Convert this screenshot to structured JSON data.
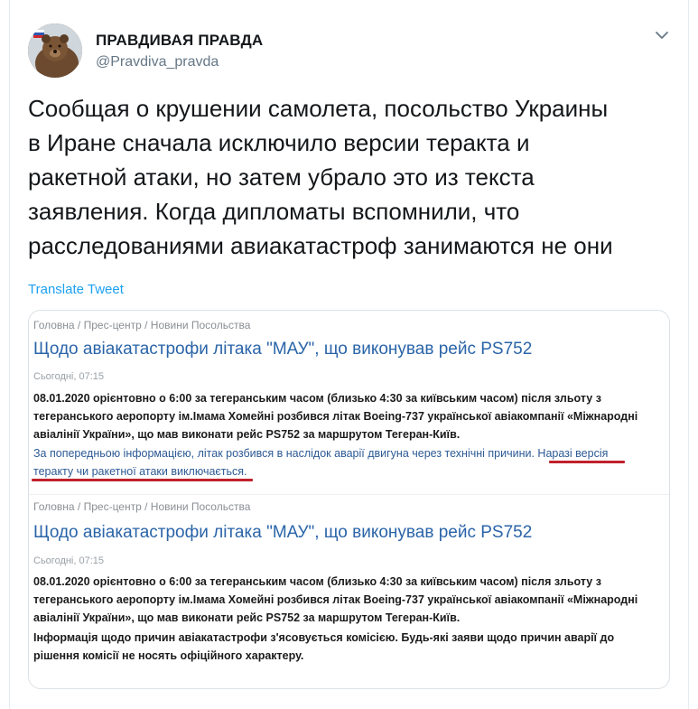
{
  "tweet": {
    "display_name": "ПРАВДИВАЯ ПРАВДА",
    "handle": "@Pravdiva_pravda",
    "text_lines": [
      "Сообщая о крушении самолета, посольство Украины",
      "в Иране сначала исключило версии теракта и",
      "ракетной атаки, но затем убрало это из текста",
      "заявления. Когда дипломаты вспомнили, что",
      "расследованиями авиакатастроф занимаются не они"
    ],
    "translate_label": "Translate Tweet"
  },
  "image": {
    "top": {
      "breadcrumb": "Головна / Прес-центр / Новини Посольства",
      "title": "Щодо авіакатастрофи літака \"МАУ\", що виконував рейс PS752",
      "date": "Сьогодні, 07:15",
      "para_lines": [
        "08.01.2020 орієнтовно о 6:00 за тегеранським часом (близько 4:30 за київським часом) після зльоту з",
        "тегеранського аеропорту ім.Імама Хомейні розбився літак Boeing-737 української авіакомпанії «Міжнародні",
        "авіалінії України», що мав виконати рейс PS752 за маршрутом Тегеран-Київ."
      ],
      "info_lines": [
        "За попередньою інформацією, літак розбився в наслідок аварії двигуна через технічні причини. Наразі версія",
        "теракту чи ракетної атаки виключається."
      ]
    },
    "bottom": {
      "breadcrumb": "Головна / Прес-центр / Новини Посольства",
      "title": "Щодо авіакатастрофи літака \"МАУ\", що виконував рейс PS752",
      "date": "Сьогодні, 07:15",
      "para_lines": [
        "08.01.2020 орієнтовно о 6:00 за тегеранським часом (близько 4:30 за київським часом) після зльоту з",
        "тегеранського аеропорту ім.Імама Хомейні розбився літак Boeing-737 української авіакомпанії «Міжнародні",
        "авіалінії України», що мав виконати рейс PS752 за маршрутом Тегеран-Київ."
      ],
      "info_lines": [
        "Інформація щодо причин авіакатастрофи з'ясовується комісією. Будь-які заяви щодо причин аварії до",
        "рішення комісії не носять офіційного характеру."
      ]
    }
  },
  "colors": {
    "link": "#1da1f2",
    "highlight": "#c0212b"
  }
}
